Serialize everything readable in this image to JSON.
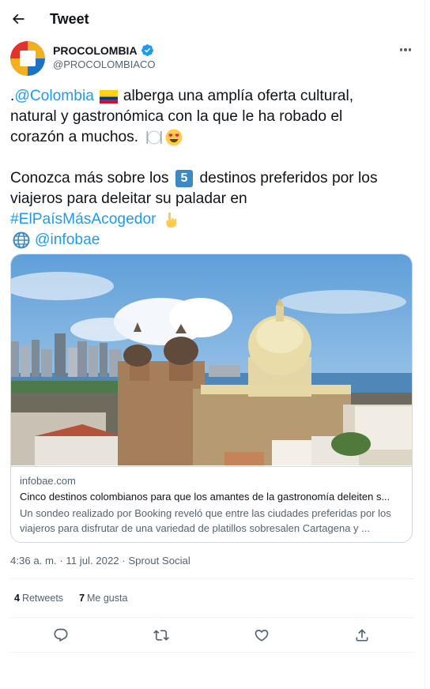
{
  "header": {
    "title": "Tweet"
  },
  "author": {
    "name": "PROCOLOMBIA",
    "handle": "@PROCOLOMBIACO"
  },
  "tweet": {
    "line1_pre": ".",
    "line1_mention": "@Colombia",
    "line1_post": "alberga una amplía oferta cultural,",
    "line2": "natural y gastronómica con la que le ha robado el",
    "line3": "corazón a muchos.",
    "line5_pre": "Conozca más sobre los",
    "line5_num": "5",
    "line5_post": "destinos preferidos por los",
    "line6": "viajeros para deleitar su paladar en",
    "hashtag": "#ElPaísMásAcogedor",
    "via_mention": "@infobae"
  },
  "card": {
    "domain": "infobae.com",
    "title": "Cinco destinos colombianos para que los amantes de la gastronomía deleiten s...",
    "desc_line1": "Un sondeo realizado por Booking reveló que entre las ciudades preferidas por los",
    "desc_line2": "viajeros para disfrutar de una variedad de platillos sobresalen Cartagena y ..."
  },
  "meta": {
    "time": "4:36 a. m.",
    "separator1": "·",
    "date": "11 jul. 2022",
    "separator2": "·",
    "source": "Sprout Social"
  },
  "stats": {
    "retweets_count": "4",
    "retweets_label": "Retweets",
    "likes_count": "7",
    "likes_label": "Me gusta"
  },
  "icons": {
    "back": "arrow-left-icon",
    "verified": "verified-badge-icon",
    "more": "more-horizontal-icon",
    "reply": "reply-icon",
    "retweet": "retweet-icon",
    "like": "heart-icon",
    "share": "share-icon",
    "flag": "colombia-flag-emoji",
    "cutlery": "fork-knife-emoji",
    "heart_eyes": "heart-eyes-emoji",
    "keycap": "keycap-five-emoji",
    "pointing": "pointing-down-emoji",
    "globe": "globe-emoji"
  },
  "colors": {
    "link": "#1d9bf0",
    "text": "#0f1419",
    "secondary": "#536471",
    "border": "#cfd9de"
  }
}
